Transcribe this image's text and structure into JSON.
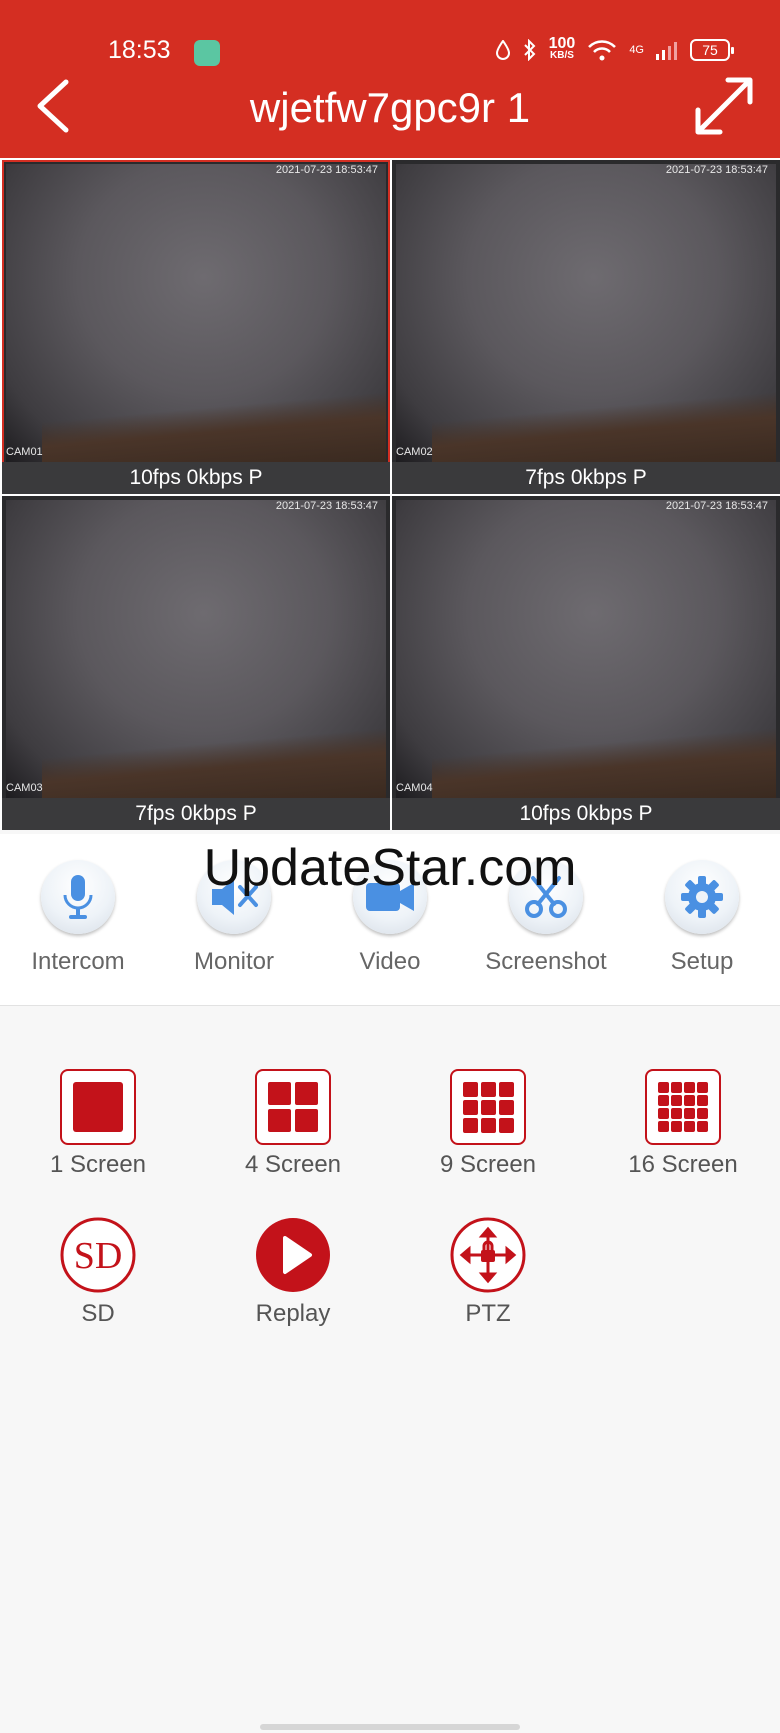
{
  "status_bar": {
    "time": "18:53",
    "speed_value": "100",
    "speed_unit": "KB/S",
    "network": "4G",
    "battery": "75"
  },
  "header": {
    "title": "wjetfw7gpc9r 1"
  },
  "cameras": [
    {
      "name": "CAM01",
      "timestamp": "2021-07-23 18:53:47",
      "stats": "10fps 0kbps P"
    },
    {
      "name": "CAM02",
      "timestamp": "2021-07-23 18:53:47",
      "stats": "7fps 0kbps P"
    },
    {
      "name": "CAM03",
      "timestamp": "2021-07-23 18:53:47",
      "stats": "7fps 0kbps P"
    },
    {
      "name": "CAM04",
      "timestamp": "2021-07-23 18:53:47",
      "stats": "10fps 0kbps P"
    }
  ],
  "watermark": "UpdateStar.com",
  "toolbar": [
    {
      "label": "Intercom",
      "icon": "microphone-icon"
    },
    {
      "label": "Monitor",
      "icon": "speaker-muted-icon"
    },
    {
      "label": "Video",
      "icon": "video-camera-icon"
    },
    {
      "label": "Screenshot",
      "icon": "scissors-icon"
    },
    {
      "label": "Setup",
      "icon": "gear-icon"
    }
  ],
  "layouts": [
    {
      "label": "1 Screen",
      "icon": "grid-1-icon"
    },
    {
      "label": "4 Screen",
      "icon": "grid-4-icon"
    },
    {
      "label": "9 Screen",
      "icon": "grid-9-icon"
    },
    {
      "label": "16 Screen",
      "icon": "grid-16-icon"
    }
  ],
  "actions": [
    {
      "label": "SD",
      "icon": "sd-card-icon",
      "glyph": "SD"
    },
    {
      "label": "Replay",
      "icon": "play-icon"
    },
    {
      "label": "PTZ",
      "icon": "ptz-arrows-icon"
    }
  ],
  "colors": {
    "header": "#d42e22",
    "accent": "#c3121a",
    "tool_blue": "#4a90e2"
  }
}
